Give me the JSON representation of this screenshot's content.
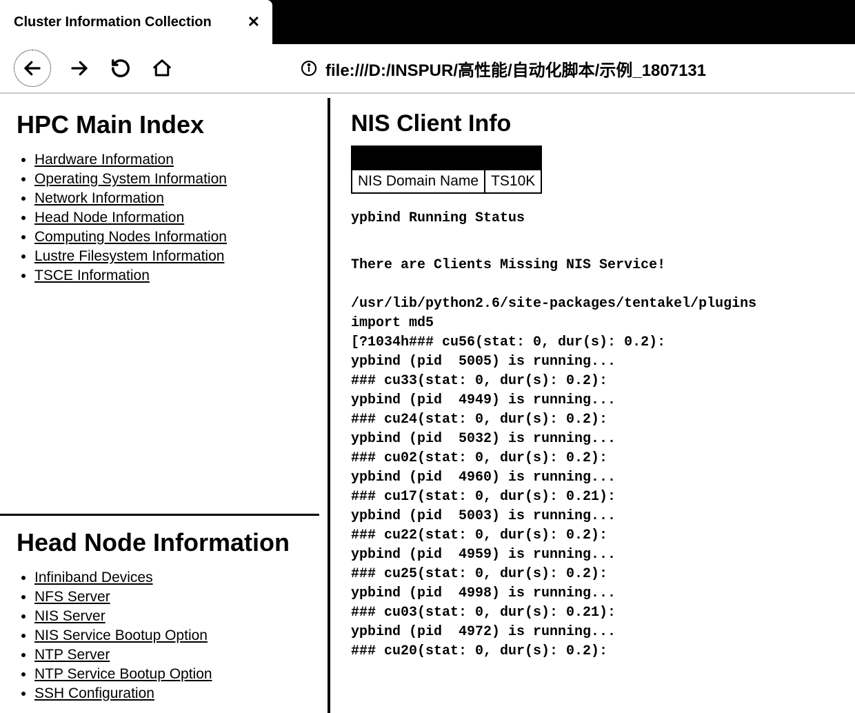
{
  "tab": {
    "title": "Cluster Information Collection"
  },
  "address": {
    "url": "file:///D:/INSPUR/高性能/自动化脚本/示例_1807131"
  },
  "sidebar": {
    "section1": {
      "title": "HPC Main Index",
      "items": [
        "Hardware Information",
        "Operating System Information",
        "Network Information",
        "Head Node Information",
        "Computing Nodes Information",
        "Lustre Filesystem Information",
        "TSCE Information"
      ]
    },
    "section2": {
      "title": "Head Node Information",
      "items": [
        "Infiniband Devices",
        "NFS Server",
        "NIS Server",
        "NIS Service Bootup Option",
        "NTP Server",
        "NTP Service Bootup Option",
        "SSH Configuration"
      ]
    }
  },
  "main": {
    "title": "NIS Client Info",
    "table": {
      "label": "NIS Domain Name",
      "value": "TS10K"
    },
    "status_header": "ypbind Running Status",
    "warning": "There are Clients Missing NIS Service!",
    "lines": [
      "/usr/lib/python2.6/site-packages/tentakel/plugins",
      "import md5",
      "[?1034h### cu56(stat: 0, dur(s): 0.2):",
      "ypbind (pid  5005) is running...",
      "### cu33(stat: 0, dur(s): 0.2):",
      "ypbind (pid  4949) is running...",
      "### cu24(stat: 0, dur(s): 0.2):",
      "ypbind (pid  5032) is running...",
      "### cu02(stat: 0, dur(s): 0.2):",
      "ypbind (pid  4960) is running...",
      "### cu17(stat: 0, dur(s): 0.21):",
      "ypbind (pid  5003) is running...",
      "### cu22(stat: 0, dur(s): 0.2):",
      "ypbind (pid  4959) is running...",
      "### cu25(stat: 0, dur(s): 0.2):",
      "ypbind (pid  4998) is running...",
      "### cu03(stat: 0, dur(s): 0.21):",
      "ypbind (pid  4972) is running...",
      "### cu20(stat: 0, dur(s): 0.2):"
    ]
  }
}
